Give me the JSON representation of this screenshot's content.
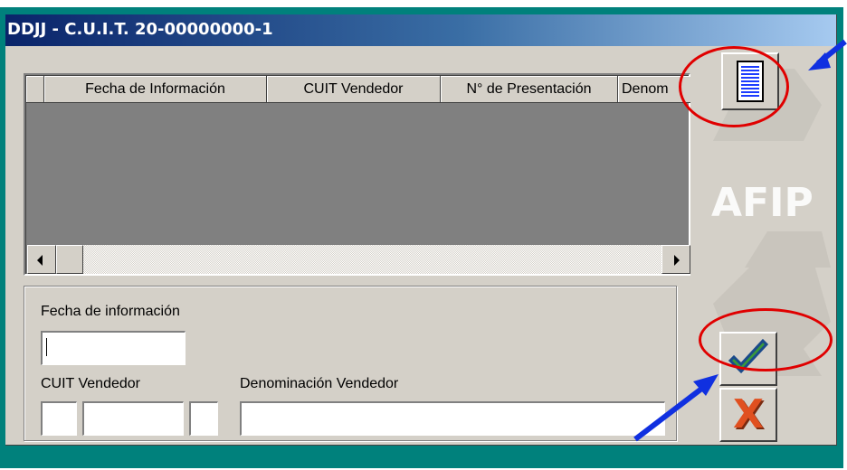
{
  "window": {
    "title": "DDJJ - C.U.I.T. 20-00000000-1"
  },
  "grid": {
    "columns": [
      "",
      "Fecha de Información",
      "CUIT Vendedor",
      "N° de Presentación",
      "Denom"
    ]
  },
  "form": {
    "fecha_label": "Fecha de información",
    "fecha_value": "",
    "cuit_label": "CUIT Vendedor",
    "cuit_part1": "",
    "cuit_part2": "",
    "cuit_part3": "",
    "denominacion_label": "Denominación Vendedor",
    "denominacion_value": ""
  },
  "toolbar": {
    "list_icon": "list-icon",
    "confirm_icon": "checkmark-icon",
    "cancel_icon": "close-icon",
    "cancel_glyph": "X"
  },
  "watermark": {
    "text": "AFIP"
  },
  "colors": {
    "desktop": "#00817c",
    "face": "#d4d0c8",
    "grid_bg": "#808080",
    "annotation_ring": "#e00000",
    "annotation_arrow": "#1030e0",
    "check_green": "#3a9a3a",
    "cancel_red": "#e05020"
  }
}
